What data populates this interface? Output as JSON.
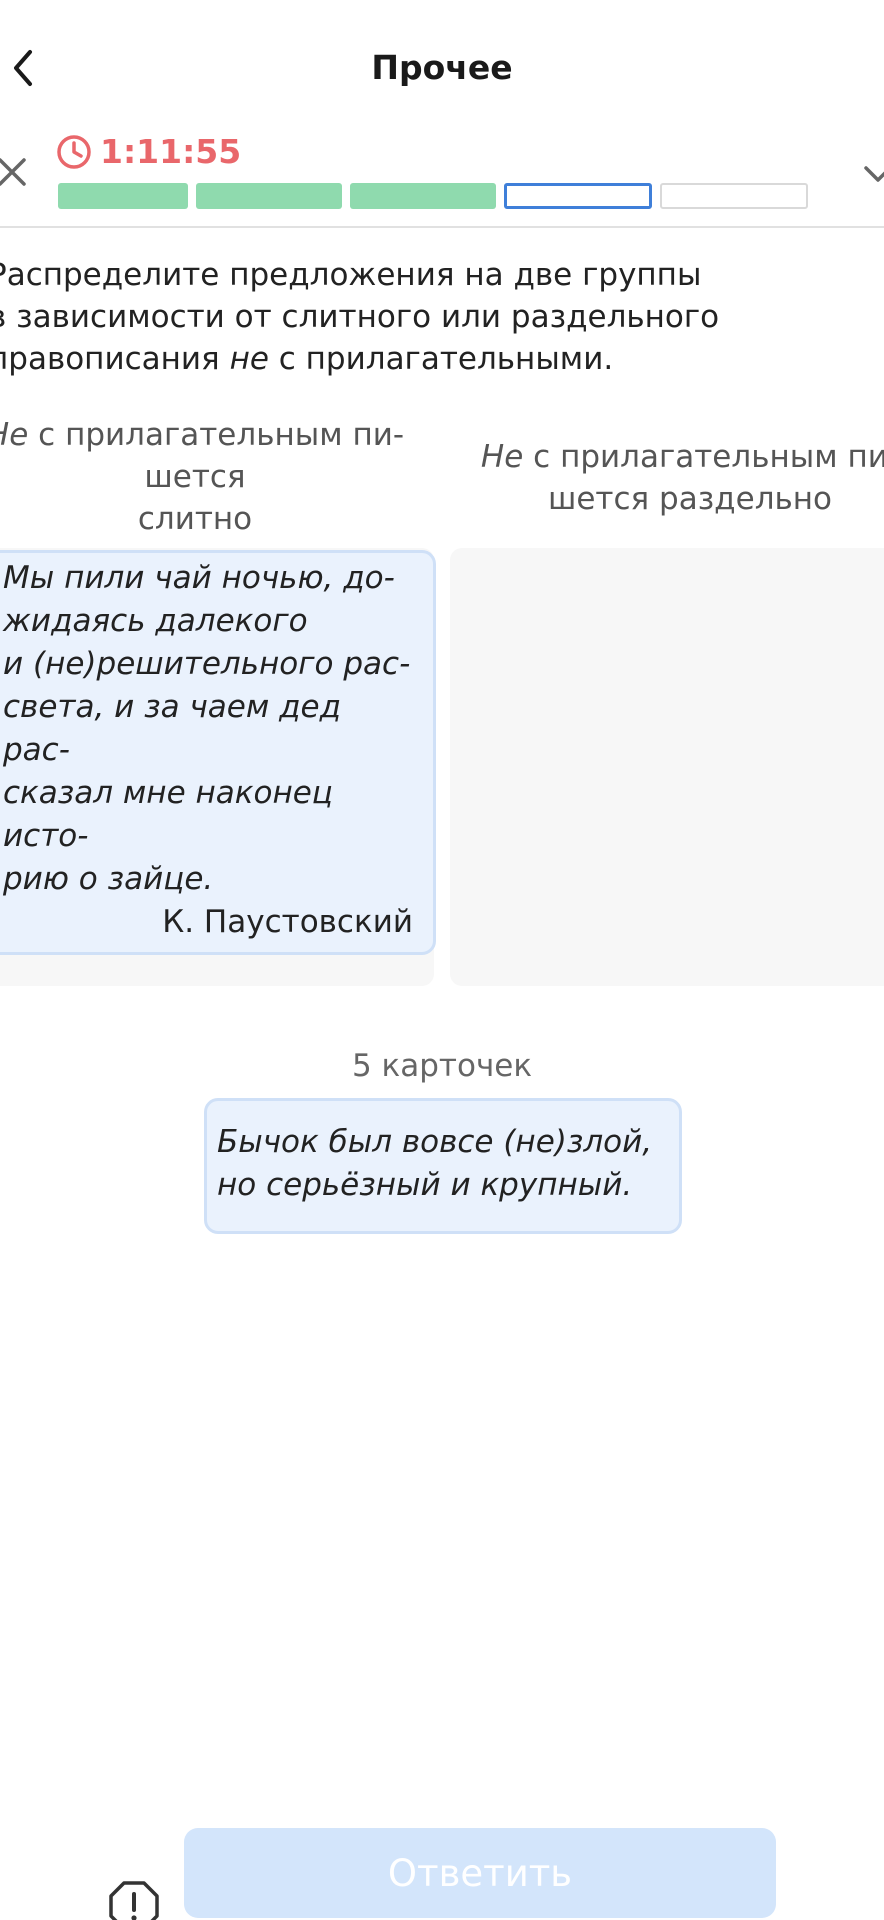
{
  "header": {
    "title": "Прочее",
    "back_icon": "chevron-left-icon"
  },
  "progress": {
    "timer": "1:11:55",
    "timer_color": "#e9676b",
    "segments": [
      {
        "state": "done"
      },
      {
        "state": "done"
      },
      {
        "state": "done"
      },
      {
        "state": "current"
      },
      {
        "state": "todo"
      }
    ],
    "done_color": "#8fdaae",
    "current_color": "#3f7fd9"
  },
  "instruction": {
    "line1": "Распределите предложения на две группы",
    "line2": "в зависимости от слитного или раздельного",
    "line3_before": "правописания ",
    "line3_em": "не",
    "line3_after": " с прилагательными."
  },
  "columns": {
    "left": {
      "head_em": "Не",
      "head_line1": " с прилагательным пи-",
      "head_line2": "шется",
      "head_line3": "слитно"
    },
    "right": {
      "head_em": "Не",
      "head_line1": " с прилагательным пи-",
      "head_line2": "шется раздельно"
    }
  },
  "placed_card": {
    "lines": [
      "Мы пили чай ночью, до-",
      "жидаясь далекого",
      "и (не)решительного рас-",
      "света, и за чаем дед рас-",
      "сказал мне наконец исто-",
      "рию о зайце."
    ],
    "author": "К. Паустовский"
  },
  "pool": {
    "count_label": "5 карточек",
    "card_line1": "Бычок был вовсе (не)злой,",
    "card_line2": "но серьёзный и крупный."
  },
  "footer": {
    "answer_label": "Ответить",
    "report_icon": "exclamation-icon"
  }
}
